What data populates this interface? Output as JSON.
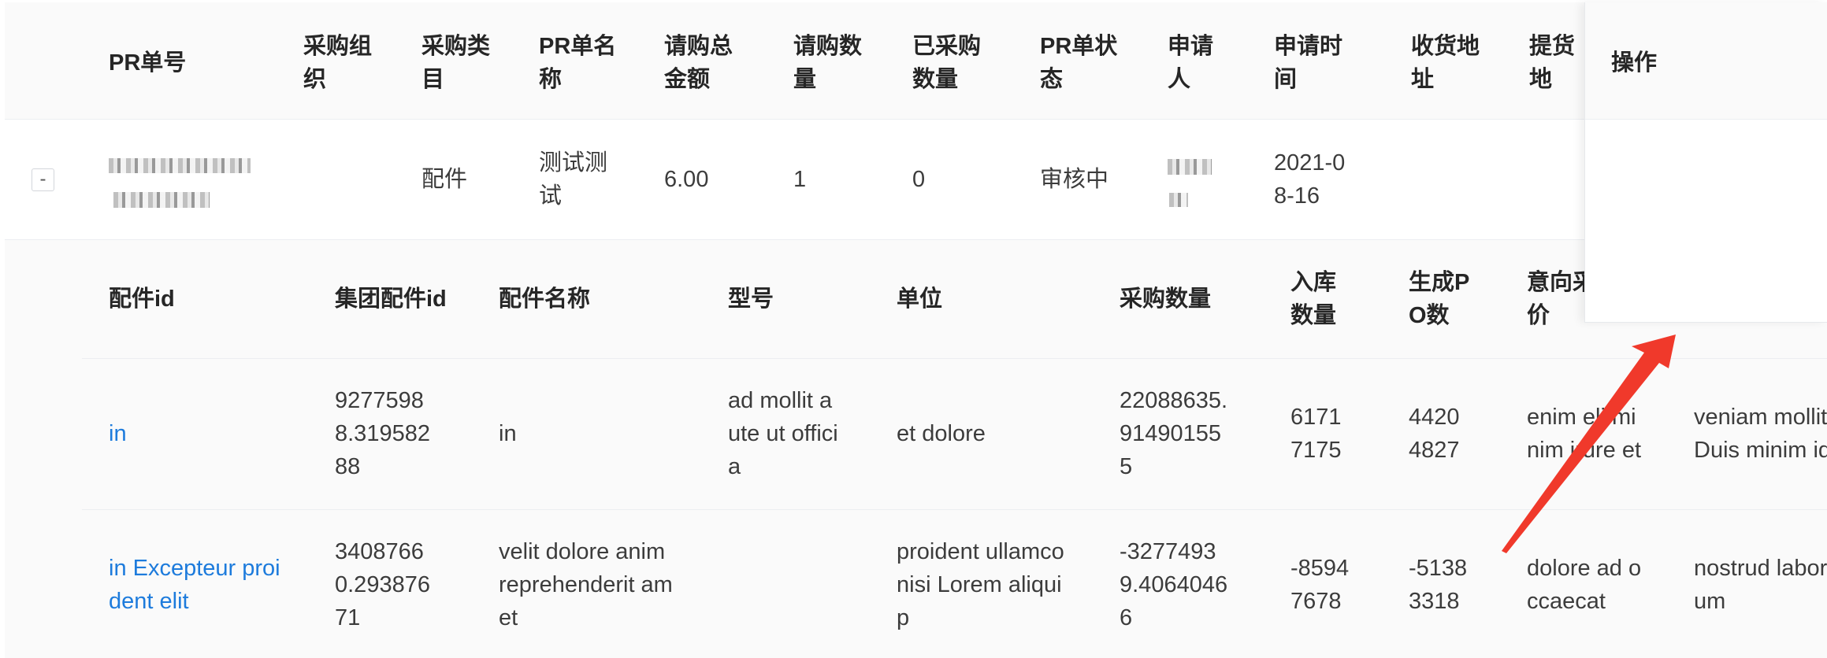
{
  "pr_table": {
    "columns": [
      "PR单号",
      "采购组\n织",
      "采购类\n目",
      "PR单名\n称",
      "请购总\n金额",
      "请购数\n量",
      "已采购\n数量",
      "PR单状\n态",
      "申请\n人",
      "申请时\n间",
      "收货地\n址",
      "提货\n地"
    ],
    "row": {
      "expand_symbol": "-",
      "category": "配件",
      "name": "测试测\n试",
      "total_amount": "6.00",
      "requested_qty": "1",
      "purchased_qty": "0",
      "status": "审核中",
      "apply_time": "2021-0\n8-16"
    }
  },
  "fixed_column": {
    "label": "操作"
  },
  "parts_table": {
    "columns": [
      "配件id",
      "集团配件id",
      "配件名称",
      "型号",
      "单位",
      "采购数量",
      "入库\n数量",
      "生成P\nO数",
      "意向采\n价"
    ],
    "rows": [
      {
        "part_id": "in",
        "group_part_id": "9277598\n8.319582\n88",
        "part_name": "in",
        "model": "ad mollit a\nute ut offici\na",
        "unit": "et dolore",
        "purchase_qty": "22088635.\n91490155\n5",
        "stock_qty": "6171\n7175",
        "po_count": "4420\n4827",
        "intended_price": "enim eli mi\nnim irure et",
        "extra": "veniam mollit\nDuis minim id"
      },
      {
        "part_id": "in Excepteur proi\ndent elit",
        "group_part_id": "3408766\n0.293876\n71",
        "part_name": "velit dolore anim\nreprehenderit am\net",
        "model": "",
        "unit": "proident ullamco\nnisi Lorem aliqui\np",
        "purchase_qty": "-3277493\n9.4064046\n6",
        "stock_qty": "-8594\n7678",
        "po_count": "-5138\n3318",
        "intended_price": "dolore ad o\nccaecat",
        "extra": "nostrud labor\num"
      }
    ]
  },
  "colors": {
    "link": "#1d7bdc",
    "arrow": "#f0392b"
  }
}
